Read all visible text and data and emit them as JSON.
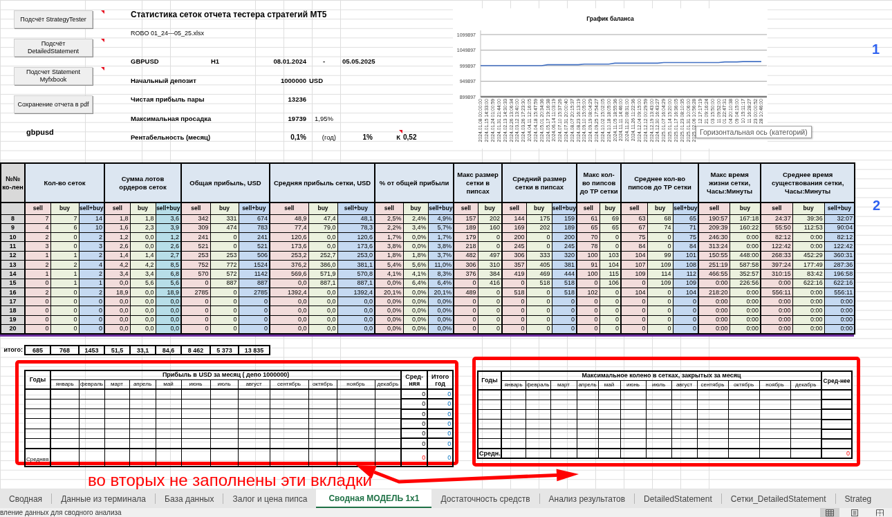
{
  "toolbar_buttons": [
    {
      "label": "Подсчёт StrategyTester",
      "comment_marker": true
    },
    {
      "label": "Подсчёт DetailedStatement",
      "comment_marker": true
    },
    {
      "label": "Подсчет Statement Myfxbook",
      "comment_marker": true
    },
    {
      "label": "Сохранение отчета в pdf",
      "comment_marker": false
    }
  ],
  "sheet_label": "gbpusd",
  "summary": {
    "title": "Статистика сеток отчета тестера стратегий МТ5",
    "file_name": "ROBO 01_24---05_25.xlsx",
    "symbol": "GBPUSD",
    "timeframe": "H1",
    "date_from": "08.01.2024",
    "date_separator": "-",
    "date_to": "05.05.2025",
    "initial_deposit": {
      "label": "Начальный депозит",
      "value": "1000000",
      "unit": "USD"
    },
    "net_profit": {
      "label": "Чистая прибыль пары",
      "value": "13236"
    },
    "max_drawdown": {
      "label": "Максимальная просадка",
      "value": "19739",
      "percent": "1,95%"
    },
    "profitability": {
      "label": "Рентабельность (месяц)",
      "month_value": "0,1%",
      "year_label": "(год)",
      "year_value": "1%",
      "k_label": "К",
      "k_value": "0,52",
      "comment_marker": true
    }
  },
  "balance_chart": {
    "chart_data": [
      {
        "type": "line",
        "title": "График баланса",
        "categories": [
          "2024.01.08 00:00:00",
          "2024.01.15 14:33:00",
          "2024.01.24 01:00:59",
          "2024.01.31 21:44:00",
          "2024.02.13 14:30:33",
          "2024.02.26 13:06:34",
          "2024.03.12 13:40:00",
          "2024.03.26 17:23:30",
          "2024.04.11 12:16:05",
          "2024.04.18 15:47:59",
          "2024.05.01 20:34:36",
          "2024.05.17 19:16:38",
          "2024.06.14 11:03:19",
          "2024.07.10 15:37:26",
          "2024.07.31 20:00:40",
          "2024.08.07 20:15:37",
          "2024.08.23 16:13:19",
          "2024.09.10 15:05:00",
          "2024.09.19 08:04:29",
          "2024.09.25 17:54:27",
          "2024.10.02 15:02:05",
          "2024.10.18 18:05:00",
          "2024.11.05 18:55:36",
          "2024.11.11 14:46:00",
          "2024.11.20 08:31:00",
          "2024.11.26 11:22:36",
          "2024.12.04 09:15:00",
          "2024.12.12 00:29:59",
          "2024.12.19 13:43:00",
          "2024.12.30 16:43:27",
          "2025.01.07 16:04:29",
          "2025.01.14 15:20:00",
          "2025.01.17 16:36:05",
          "2025.01.23 08:10:35",
          "2025.01.31 10:06:00",
          "2025.02.06 10:56:28",
          "12 17:17:19",
          "21 09:16:24",
          "03 15:50:00",
          "11 09:52:00",
          "01 22:47:31",
          "04 20:10:38",
          "09 04:15:00",
          "10 15:11:17",
          "11 16:28:27",
          "23 00:00:52",
          "28 10:46:00"
        ],
        "values": [
          1000000,
          1000000,
          1000000,
          1000000,
          1000000,
          1000000,
          1000000,
          1000000,
          1000000,
          1000000,
          1000000,
          1003000,
          1003000,
          1003000,
          1003000,
          1003000,
          1003000,
          1005000,
          1005000,
          1005000,
          1005000,
          1005000,
          1008000,
          1008000,
          1008000,
          1008000,
          1008000,
          1008000,
          1008000,
          1008000,
          1010000,
          1010000,
          1010000,
          1010000,
          1010000,
          1010000,
          1010000,
          1010000,
          1010000,
          1010000,
          1012000,
          1012000,
          1012000,
          1013000,
          1013000,
          1013000,
          1013000
        ],
        "yticks": [
          899897,
          949897,
          999897,
          1049897,
          1099897
        ],
        "ylim": [
          899897,
          1099897
        ],
        "grid": true,
        "color": "#4472c4"
      }
    ]
  },
  "axis_tooltip": "Горизонтальная ось (категорий)",
  "annotations": {
    "marker_1": "1",
    "marker_2": "2",
    "note": "во вторых не заполнены эти вкладки"
  },
  "grid_table": {
    "row_header": "№№ ко-лен",
    "groups": [
      {
        "label": "Кол-во сеток",
        "columns": [
          {
            "label": "sell",
            "kind": "sell"
          },
          {
            "label": "buy",
            "kind": "buy"
          },
          {
            "label": "sell+buy",
            "kind": "total"
          }
        ]
      },
      {
        "label": "Сумма лотов ордеров сеток",
        "columns": [
          {
            "label": "sell",
            "kind": "sell"
          },
          {
            "label": "buy",
            "kind": "buy"
          },
          {
            "label": "sell+buy",
            "kind": "sum"
          }
        ]
      },
      {
        "label": "Общая прибыль, USD",
        "columns": [
          {
            "label": "sell",
            "kind": "sell"
          },
          {
            "label": "buy",
            "kind": "buy"
          },
          {
            "label": "sell+buy",
            "kind": "total"
          }
        ]
      },
      {
        "label": "Средняя прибыль сетки, USD",
        "columns": [
          {
            "label": "sell",
            "kind": "sell"
          },
          {
            "label": "buy",
            "kind": "buy"
          },
          {
            "label": "sell+buy",
            "kind": "total"
          }
        ]
      },
      {
        "label": "% от общей прибыли",
        "columns": [
          {
            "label": "sell",
            "kind": "sell"
          },
          {
            "label": "buy",
            "kind": "buy"
          },
          {
            "label": "sell+buy",
            "kind": "total"
          }
        ]
      },
      {
        "label": "Макс размер сетки в пипсах",
        "columns": [
          {
            "label": "sell",
            "kind": "sell"
          },
          {
            "label": "buy",
            "kind": "buy"
          }
        ]
      },
      {
        "label": "Средний размер сетки в пипсах",
        "columns": [
          {
            "label": "sell",
            "kind": "sell"
          },
          {
            "label": "buy",
            "kind": "buy"
          },
          {
            "label": "sell+buy",
            "kind": "total"
          }
        ]
      },
      {
        "label": "Макс кол-во пипсов до TP сетки",
        "columns": [
          {
            "label": "sell",
            "kind": "sell"
          },
          {
            "label": "buy",
            "kind": "buy"
          }
        ]
      },
      {
        "label": "Среднее кол-во пипсов до TP сетки",
        "columns": [
          {
            "label": "sell",
            "kind": "sell"
          },
          {
            "label": "buy",
            "kind": "buy"
          },
          {
            "label": "sell+buy",
            "kind": "total"
          }
        ]
      },
      {
        "label": "Макс время жизни сетки, Часы:Минуты",
        "columns": [
          {
            "label": "sell",
            "kind": "sell"
          },
          {
            "label": "buy",
            "kind": "buy"
          }
        ]
      },
      {
        "label": "Среднее время существования сетки, Часы:Минуты",
        "columns": [
          {
            "label": "sell",
            "kind": "sell"
          },
          {
            "label": "buy",
            "kind": "buy"
          },
          {
            "label": "sell+buy",
            "kind": "total"
          }
        ]
      }
    ],
    "rows": [
      {
        "label": "8",
        "cells": [
          "7",
          "7",
          "14",
          "1,8",
          "1,8",
          "3,6",
          "342",
          "331",
          "674",
          "48,9",
          "47,4",
          "48,1",
          "2,5%",
          "2,4%",
          "4,9%",
          "157",
          "202",
          "144",
          "175",
          "159",
          "61",
          "69",
          "63",
          "68",
          "65",
          "190:57",
          "167:18",
          "24:37",
          "39:36",
          "32:07"
        ]
      },
      {
        "label": "9",
        "cells": [
          "4",
          "6",
          "10",
          "1,6",
          "2,3",
          "3,9",
          "309",
          "474",
          "783",
          "77,4",
          "79,0",
          "78,3",
          "2,2%",
          "3,4%",
          "5,7%",
          "189",
          "160",
          "169",
          "202",
          "189",
          "65",
          "65",
          "67",
          "74",
          "71",
          "209:39",
          "160:22",
          "55:50",
          "112:53",
          "90:04"
        ]
      },
      {
        "label": "10",
        "cells": [
          "2",
          "0",
          "2",
          "1,2",
          "0,0",
          "1,2",
          "241",
          "0",
          "241",
          "120,6",
          "0,0",
          "120,6",
          "1,7%",
          "0,0%",
          "1,7%",
          "179",
          "0",
          "200",
          "0",
          "200",
          "70",
          "0",
          "75",
          "0",
          "75",
          "246:30",
          "0:00",
          "82:12",
          "0:00",
          "82:12"
        ]
      },
      {
        "label": "11",
        "cells": [
          "3",
          "0",
          "3",
          "2,6",
          "0,0",
          "2,6",
          "521",
          "0",
          "521",
          "173,6",
          "0,0",
          "173,6",
          "3,8%",
          "0,0%",
          "3,8%",
          "218",
          "0",
          "245",
          "0",
          "245",
          "78",
          "0",
          "84",
          "0",
          "84",
          "313:24",
          "0:00",
          "122:42",
          "0:00",
          "122:42"
        ]
      },
      {
        "label": "12",
        "cells": [
          "1",
          "1",
          "2",
          "1,4",
          "1,4",
          "2,7",
          "253",
          "253",
          "506",
          "253,2",
          "252,7",
          "253,0",
          "1,8%",
          "1,8%",
          "3,7%",
          "482",
          "497",
          "306",
          "333",
          "320",
          "100",
          "103",
          "104",
          "99",
          "101",
          "150:55",
          "448:00",
          "268:33",
          "452:29",
          "360:31"
        ]
      },
      {
        "label": "13",
        "cells": [
          "2",
          "2",
          "4",
          "4,2",
          "4,2",
          "8,5",
          "752",
          "772",
          "1524",
          "376,2",
          "386,0",
          "381,1",
          "5,4%",
          "5,6%",
          "11,0%",
          "306",
          "310",
          "357",
          "405",
          "381",
          "91",
          "104",
          "107",
          "109",
          "108",
          "251:19",
          "587:58",
          "397:24",
          "177:49",
          "287:36"
        ]
      },
      {
        "label": "14",
        "cells": [
          "1",
          "1",
          "2",
          "3,4",
          "3,4",
          "6,8",
          "570",
          "572",
          "1142",
          "569,6",
          "571,9",
          "570,8",
          "4,1%",
          "4,1%",
          "8,3%",
          "376",
          "384",
          "419",
          "469",
          "444",
          "100",
          "115",
          "109",
          "114",
          "112",
          "466:55",
          "352:57",
          "310:15",
          "83:42",
          "196:58"
        ]
      },
      {
        "label": "15",
        "cells": [
          "0",
          "1",
          "1",
          "0,0",
          "5,6",
          "5,6",
          "0",
          "887",
          "887",
          "0,0",
          "887,1",
          "887,1",
          "0,0%",
          "6,4%",
          "6,4%",
          "0",
          "416",
          "0",
          "518",
          "518",
          "0",
          "106",
          "0",
          "109",
          "109",
          "0:00",
          "226:56",
          "0:00",
          "622:16",
          "622:16"
        ]
      },
      {
        "label": "16",
        "cells": [
          "2",
          "0",
          "2",
          "18,9",
          "0,0",
          "18,9",
          "2785",
          "0",
          "2785",
          "1392,4",
          "0,0",
          "1392,4",
          "20,1%",
          "0,0%",
          "20,1%",
          "489",
          "0",
          "518",
          "0",
          "518",
          "102",
          "0",
          "104",
          "0",
          "104",
          "218:20",
          "0:00",
          "556:11",
          "0:00",
          "556:11"
        ]
      },
      {
        "label": "17",
        "cells": [
          "0",
          "0",
          "0",
          "0,0",
          "0,0",
          "0,0",
          "0",
          "0",
          "0",
          "0,0",
          "0,0",
          "0,0",
          "0,0%",
          "0,0%",
          "0,0%",
          "0",
          "0",
          "0",
          "0",
          "0",
          "0",
          "0",
          "0",
          "0",
          "0",
          "0:00",
          "0:00",
          "0:00",
          "0:00",
          "0:00"
        ]
      },
      {
        "label": "18",
        "cells": [
          "0",
          "0",
          "0",
          "0,0",
          "0,0",
          "0,0",
          "0",
          "0",
          "0",
          "0,0",
          "0,0",
          "0,0",
          "0,0%",
          "0,0%",
          "0,0%",
          "0",
          "0",
          "0",
          "0",
          "0",
          "0",
          "0",
          "0",
          "0",
          "0",
          "0:00",
          "0:00",
          "0:00",
          "0:00",
          "0:00"
        ]
      },
      {
        "label": "19",
        "cells": [
          "0",
          "0",
          "0",
          "0,0",
          "0,0",
          "0,0",
          "0",
          "0",
          "0",
          "0,0",
          "0,0",
          "0,0",
          "0,0%",
          "0,0%",
          "0,0%",
          "0",
          "0",
          "0",
          "0",
          "0",
          "0",
          "0",
          "0",
          "0",
          "0",
          "0:00",
          "0:00",
          "0:00",
          "0:00",
          "0:00"
        ]
      },
      {
        "label": "20",
        "cells": [
          "0",
          "0",
          "0",
          "0,0",
          "0,0",
          "0,0",
          "0",
          "0",
          "0",
          "0,0",
          "0,0",
          "0,0",
          "0,0%",
          "0,0%",
          "0,0%",
          "0",
          "0",
          "0",
          "0",
          "0",
          "0",
          "0",
          "0",
          "0",
          "0",
          "0:00",
          "0:00",
          "0:00",
          "0:00",
          "0:00"
        ]
      }
    ]
  },
  "totals": {
    "label": "итого:",
    "values": [
      "685",
      "768",
      "1453",
      "51,5",
      "33,1",
      "84,6",
      "8 462",
      "5 373",
      "13 835"
    ]
  },
  "monthly_profit_table": {
    "year_header": "Годы",
    "title": "Прибыль в USD за месяц ( депо 1000000)",
    "months": [
      "январь",
      "февраль",
      "март",
      "апрель",
      "май",
      "июнь",
      "июль",
      "август",
      "сентябрь",
      "октябрь",
      "ноябрь",
      "декабрь"
    ],
    "average_header": "Сред-няя",
    "total_header": "Итого год",
    "rows": [
      {
        "average": "0",
        "total": "0"
      },
      {
        "average": "0",
        "total": "0"
      },
      {
        "average": "0",
        "total": "0"
      },
      {
        "average": "0",
        "total": "0"
      },
      {
        "average": "0",
        "total": "0"
      },
      {
        "average": "0",
        "total": "0"
      }
    ],
    "footer": {
      "label": "Средняя",
      "average": "0",
      "total": "0"
    }
  },
  "max_knee_table": {
    "year_header": "Годы",
    "title": "Максимальное колено в сетках, закрытых за месяц",
    "months": [
      "январь",
      "февраль",
      "март",
      "апрель",
      "май",
      "июнь",
      "июль",
      "август",
      "сентябрь",
      "октябрь",
      "ноябрь",
      "декабрь"
    ],
    "average_header": "Сред-нее",
    "footer": {
      "label": "Средн.",
      "average": "0"
    }
  },
  "sheet_tabs": [
    {
      "label": "Сводная",
      "selected": false
    },
    {
      "label": "Данные из терминала",
      "selected": false
    },
    {
      "label": "База данных",
      "selected": false
    },
    {
      "label": "Залог и цена пипса",
      "selected": false
    },
    {
      "label": "Сводная МОДЕЛЬ 1x1",
      "selected": true
    },
    {
      "label": "Достаточность средств",
      "selected": false
    },
    {
      "label": "Анализ результатов",
      "selected": false
    },
    {
      "label": "DetailedStatement",
      "selected": false
    },
    {
      "label": "Сетки_DetailedStatement",
      "selected": false
    },
    {
      "label": "Strateg",
      "selected": false
    }
  ],
  "status_bar": {
    "text": "вление данных для сводного анализа",
    "views": [
      {
        "kind": "normal",
        "selected": true
      },
      {
        "kind": "page_layout",
        "selected": false
      },
      {
        "kind": "page_break",
        "selected": false
      }
    ]
  }
}
